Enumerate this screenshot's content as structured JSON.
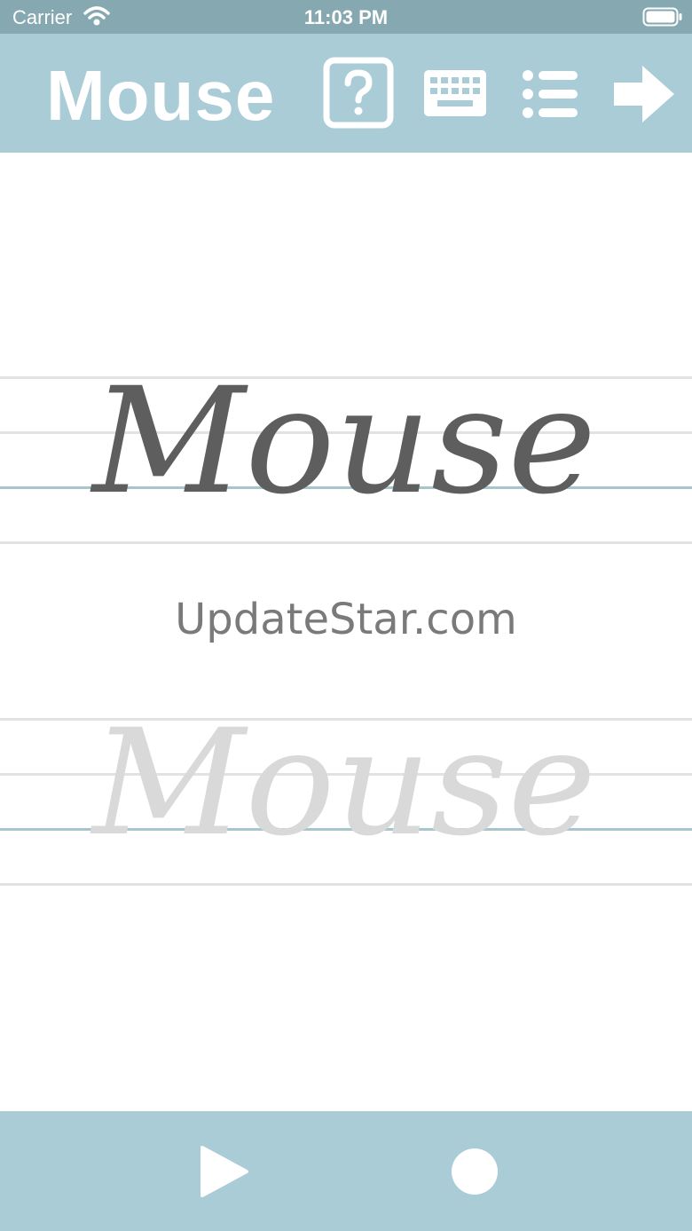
{
  "status_bar": {
    "carrier": "Carrier",
    "time": "11:03 PM"
  },
  "header": {
    "title": "Mouse",
    "icons": [
      "help-icon",
      "keyboard-icon",
      "list-icon",
      "next-arrow-icon"
    ]
  },
  "content": {
    "model_word": "Mouse",
    "trace_word": "Mouse",
    "watermark": "UpdateStar.com"
  },
  "toolbar": {
    "icons": [
      "play-icon",
      "record-icon"
    ]
  },
  "colors": {
    "status_bar": "#86a8b0",
    "bars": "#a9ccd6",
    "model_ink": "#5e5e5e",
    "trace_ink": "#d9d9d9",
    "guide_line": "#e2e2e2",
    "baseline": "#a6c6cc"
  }
}
